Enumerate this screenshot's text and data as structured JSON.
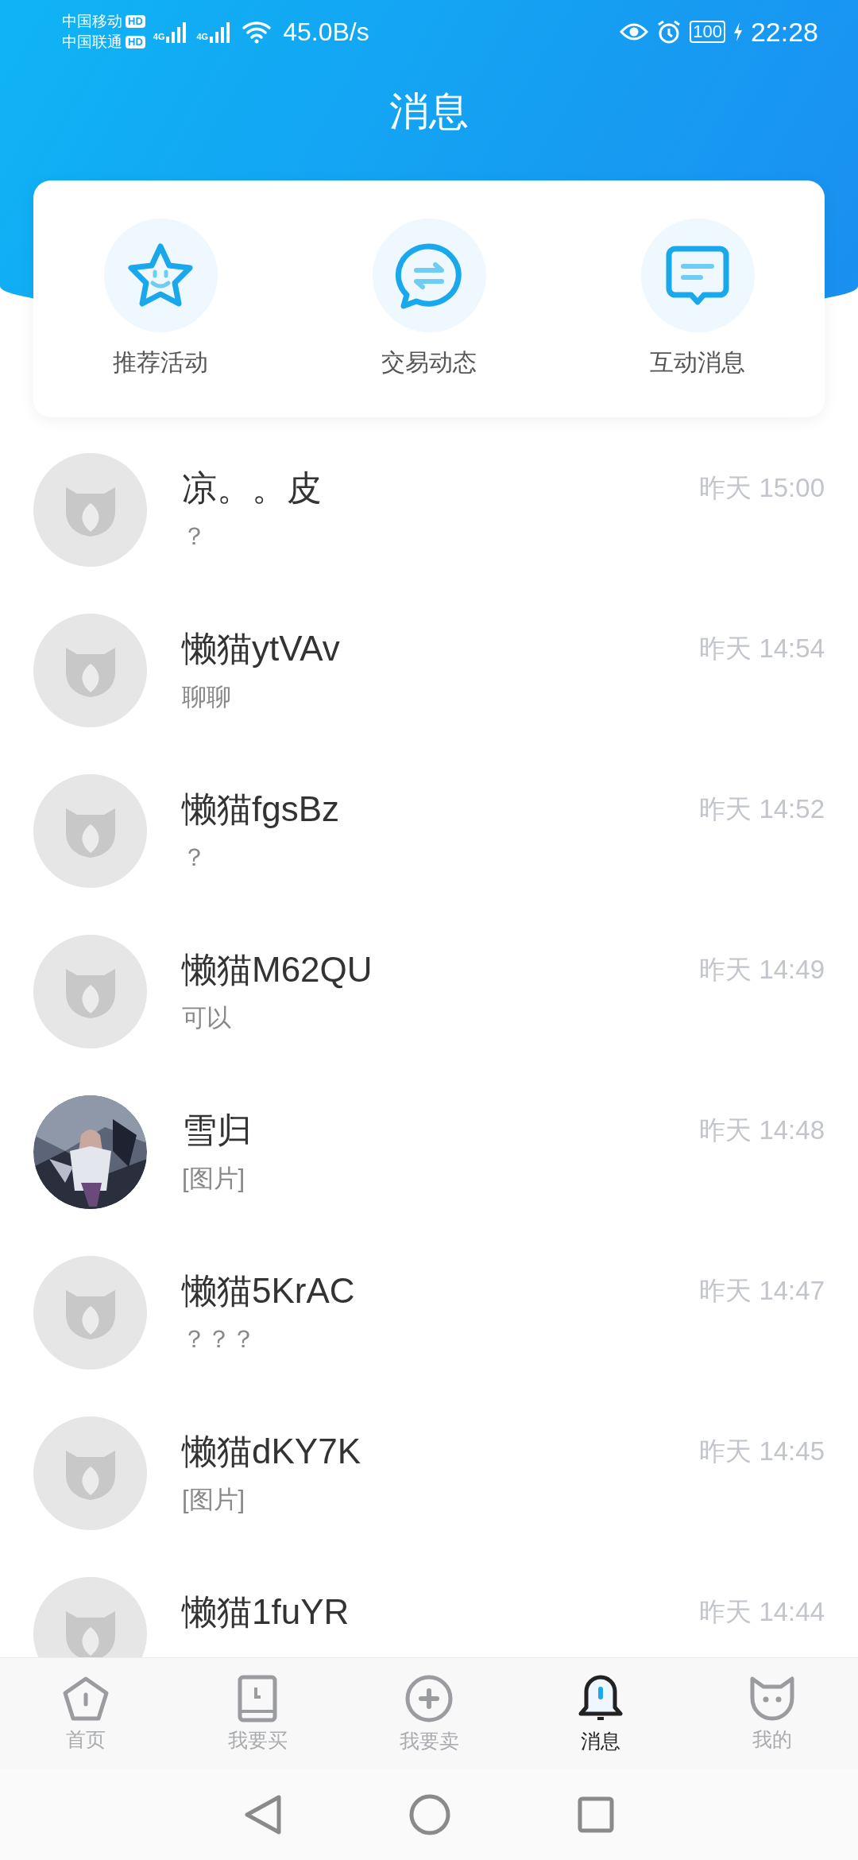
{
  "status_bar": {
    "carriers": [
      {
        "name": "中国移动",
        "badge": "HD"
      },
      {
        "name": "中国联通",
        "badge": "HD"
      }
    ],
    "networks": [
      "4G",
      "4G"
    ],
    "speed": "45.0B/s",
    "battery": "100",
    "time": "22:28"
  },
  "title": "消息",
  "shortcuts": [
    {
      "label": "推荐活动",
      "kind": "star"
    },
    {
      "label": "交易动态",
      "kind": "exchange"
    },
    {
      "label": "互动消息",
      "kind": "message"
    }
  ],
  "conversations": [
    {
      "name": "凉。。皮",
      "preview": "？",
      "time": "昨天 15:00",
      "kind": "default"
    },
    {
      "name": "懒猫ytVAv",
      "preview": "聊聊",
      "time": "昨天 14:54",
      "kind": "default"
    },
    {
      "name": "懒猫fgsBz",
      "preview": "？",
      "time": "昨天 14:52",
      "kind": "default"
    },
    {
      "name": "懒猫M62QU",
      "preview": "可以",
      "time": "昨天 14:49",
      "kind": "default"
    },
    {
      "name": "雪归",
      "preview": "[图片]",
      "time": "昨天 14:48",
      "kind": "picture"
    },
    {
      "name": "懒猫5KrAC",
      "preview": "？？？",
      "time": "昨天 14:47",
      "kind": "default"
    },
    {
      "name": "懒猫dKY7K",
      "preview": "[图片]",
      "time": "昨天 14:45",
      "kind": "default"
    },
    {
      "name": "懒猫1fuYR",
      "time": "昨天 14:44",
      "kind": "default"
    }
  ],
  "tabs": [
    {
      "label": "首页",
      "kind": "home",
      "selected": false
    },
    {
      "label": "我要买",
      "kind": "book",
      "selected": false
    },
    {
      "label": "我要卖",
      "kind": "plus",
      "selected": false
    },
    {
      "label": "消息",
      "kind": "bell",
      "selected": true
    },
    {
      "label": "我的",
      "kind": "cat",
      "selected": false
    }
  ]
}
